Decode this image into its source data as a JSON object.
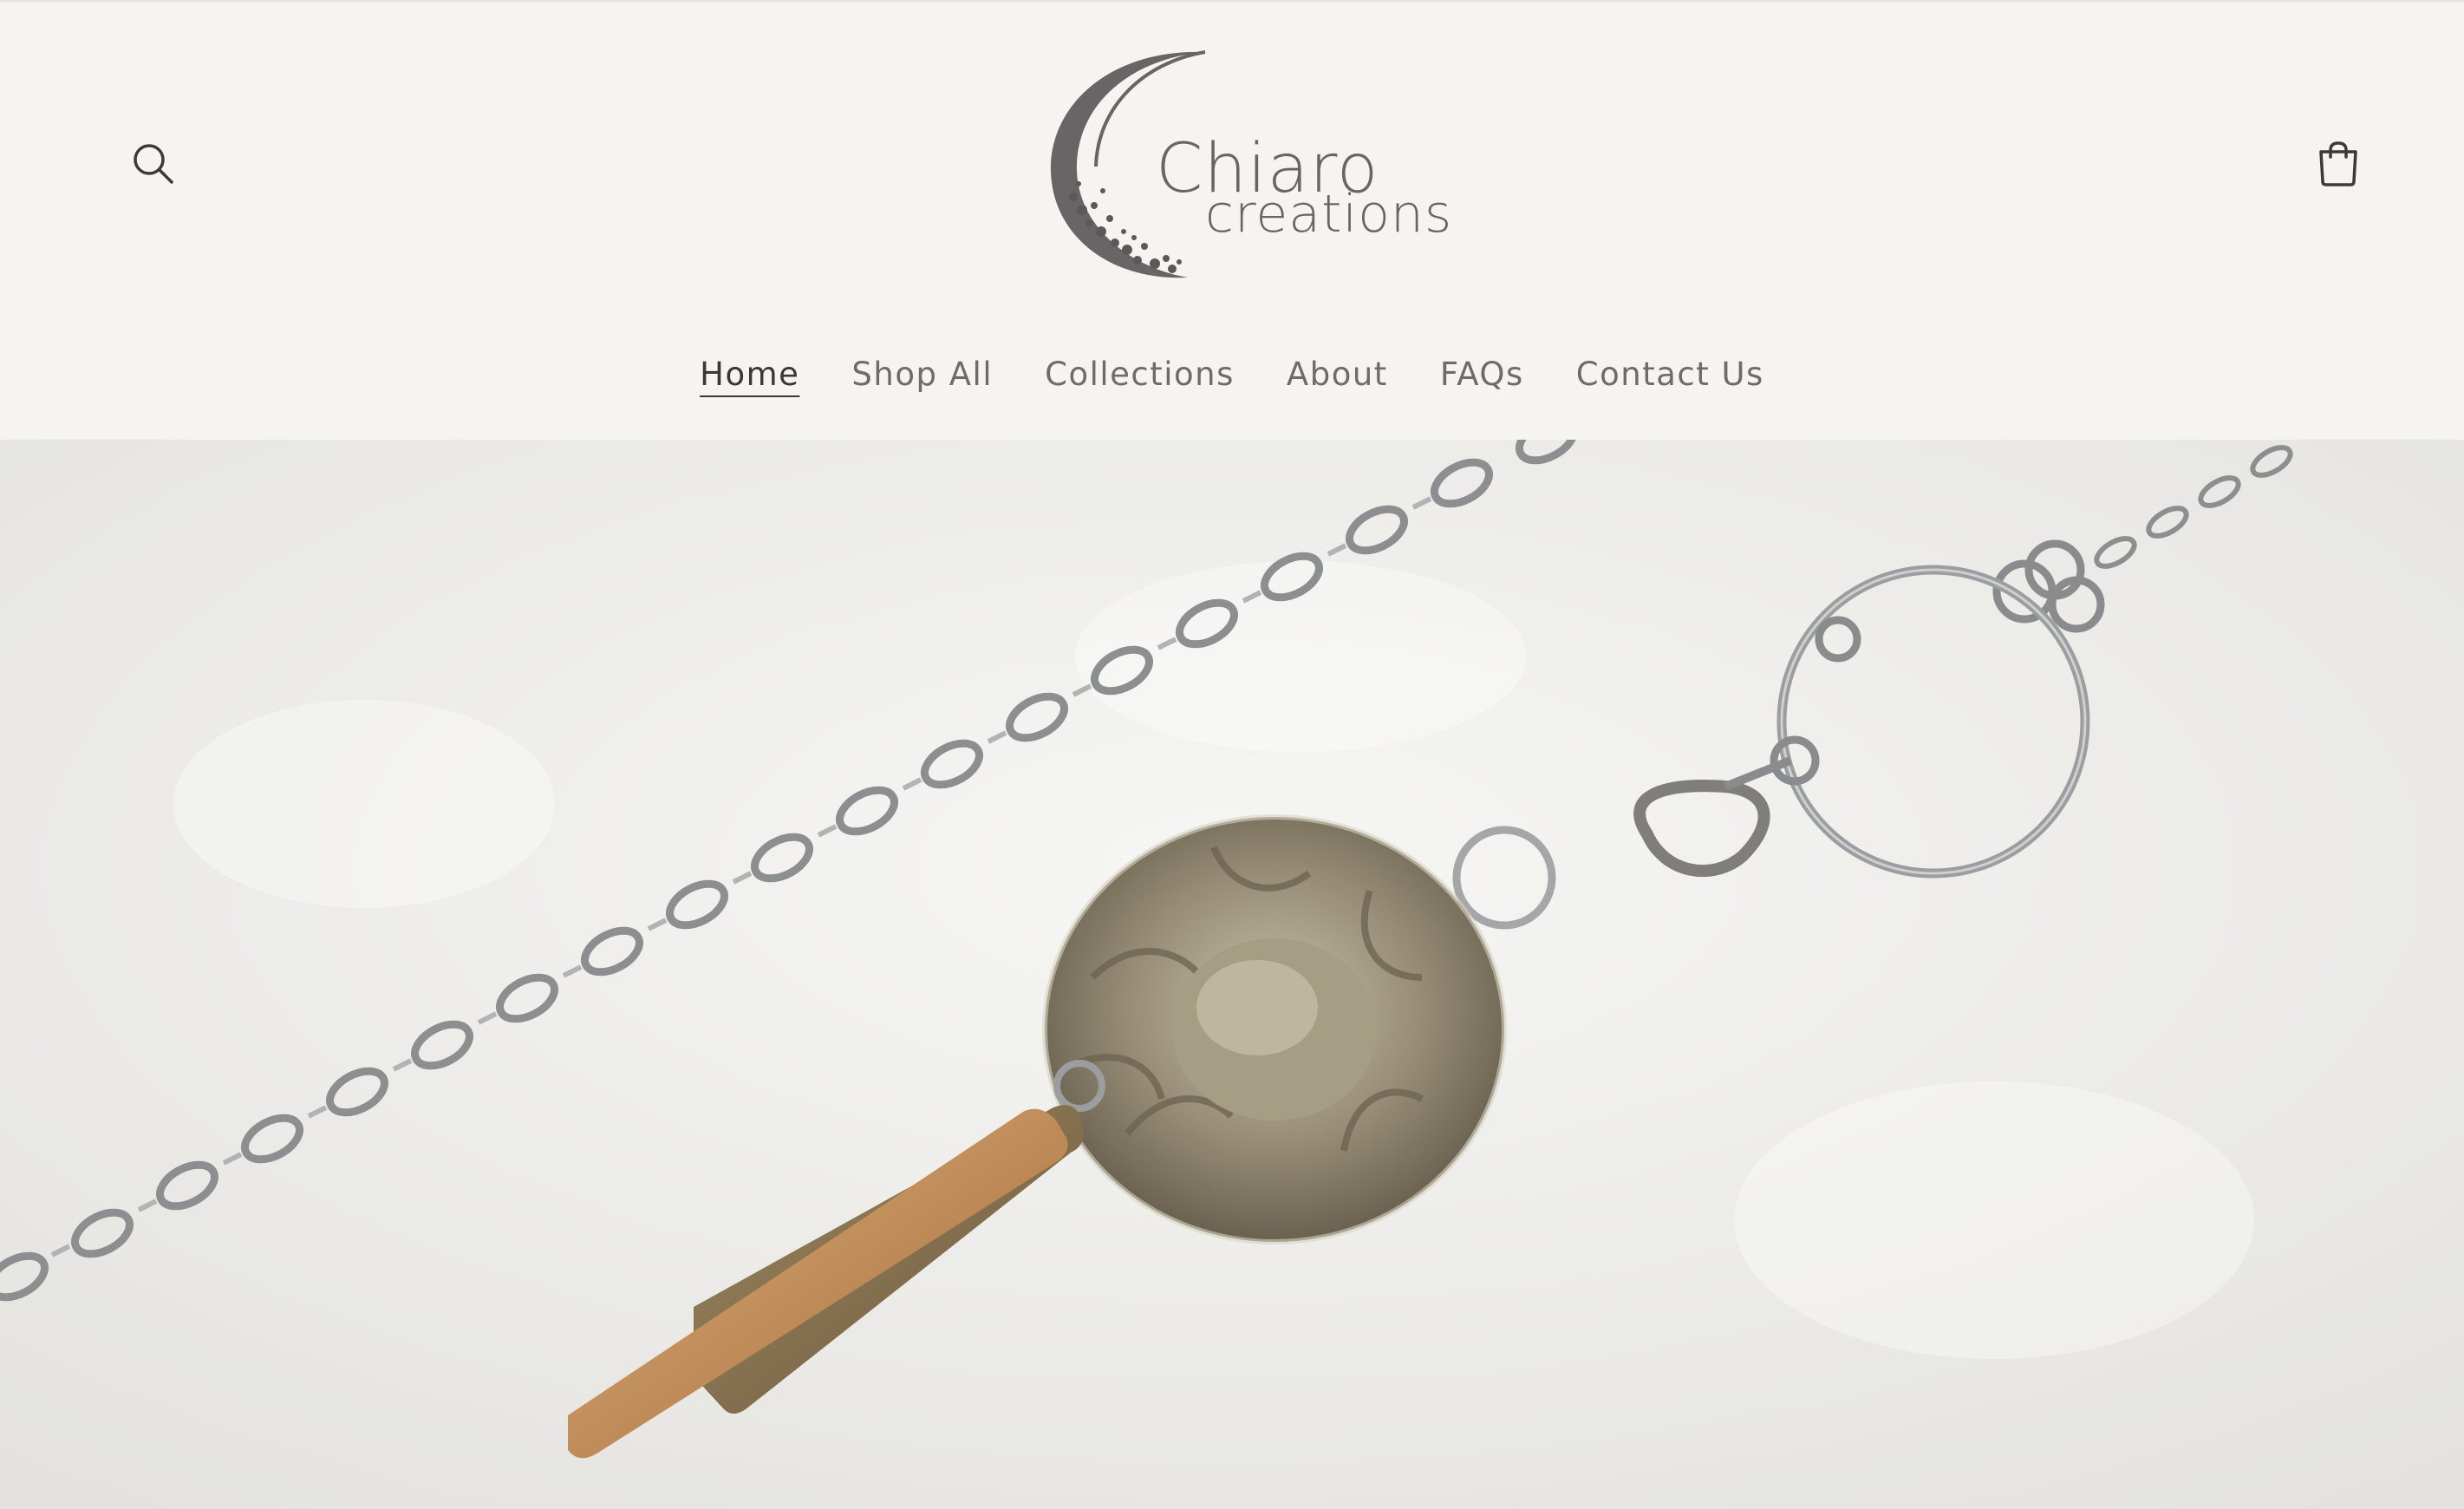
{
  "header": {
    "logo": {
      "line1": "Chiaro",
      "line2": "creations"
    },
    "search_icon": "search-icon",
    "cart_icon": "cart-icon"
  },
  "nav": {
    "items": [
      {
        "label": "Home",
        "active": true
      },
      {
        "label": "Shop All",
        "active": false
      },
      {
        "label": "Collections",
        "active": false
      },
      {
        "label": "About",
        "active": false
      },
      {
        "label": "FAQs",
        "active": false
      },
      {
        "label": "Contact Us",
        "active": false
      }
    ]
  },
  "colors": {
    "header_bg": "#f6f4f0",
    "text": "#6e6c69",
    "active_text": "#3a3836"
  }
}
